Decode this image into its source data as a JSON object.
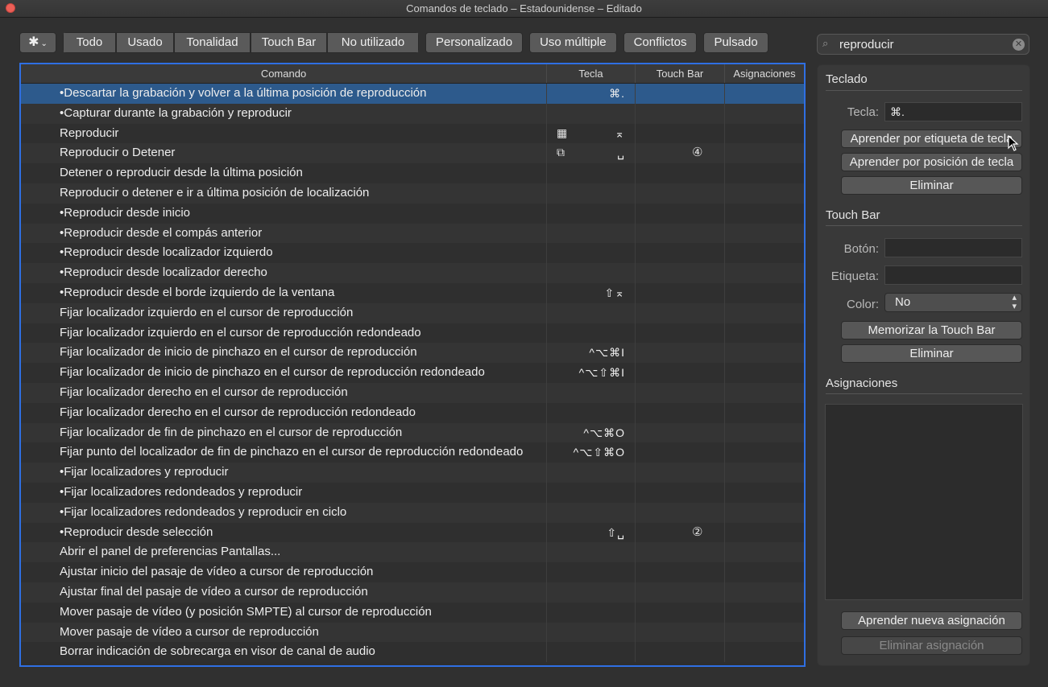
{
  "window": {
    "title": "Comandos de teclado – Estadounidense – Editado"
  },
  "toolbar": {
    "gear_icon": "gear-icon",
    "filters": [
      "Todo",
      "Usado",
      "Tonalidad",
      "Touch Bar",
      "No utilizado"
    ],
    "personalizado": "Personalizado",
    "uso_multiple": "Uso múltiple",
    "conflictos": "Conflictos",
    "pulsado": "Pulsado"
  },
  "search": {
    "value": "reproducir"
  },
  "table": {
    "headers": {
      "comando": "Comando",
      "tecla": "Tecla",
      "touch_bar": "Touch Bar",
      "asignaciones": "Asignaciones"
    },
    "rows": [
      {
        "cmd": "•Descartar la grabación y volver a la última posición de reproducción",
        "key": "⌘.",
        "icon": "",
        "tb": ""
      },
      {
        "cmd": "•Capturar durante la grabación y reproducir",
        "key": "",
        "icon": "",
        "tb": ""
      },
      {
        "cmd": "Reproducir",
        "key": "⌅",
        "icon": "▦",
        "tb": ""
      },
      {
        "cmd": "Reproducir o Detener",
        "key": "␣",
        "icon": "⧉",
        "tb": "④"
      },
      {
        "cmd": "Detener o reproducir desde la última posición",
        "key": "",
        "icon": "",
        "tb": ""
      },
      {
        "cmd": "Reproducir o detener e ir a última posición de localización",
        "key": "",
        "icon": "",
        "tb": ""
      },
      {
        "cmd": "•Reproducir desde inicio",
        "key": "",
        "icon": "",
        "tb": ""
      },
      {
        "cmd": "•Reproducir desde el compás anterior",
        "key": "",
        "icon": "",
        "tb": ""
      },
      {
        "cmd": "•Reproducir desde localizador izquierdo",
        "key": "",
        "icon": "",
        "tb": ""
      },
      {
        "cmd": "•Reproducir desde localizador derecho",
        "key": "",
        "icon": "",
        "tb": ""
      },
      {
        "cmd": "•Reproducir desde el borde izquierdo de la ventana",
        "key": "⇧⌅",
        "icon": "",
        "tb": ""
      },
      {
        "cmd": "Fijar localizador izquierdo en el cursor de reproducción",
        "key": "",
        "icon": "",
        "tb": ""
      },
      {
        "cmd": "Fijar localizador izquierdo en el cursor de reproducción redondeado",
        "key": "",
        "icon": "",
        "tb": ""
      },
      {
        "cmd": "Fijar localizador de inicio de pinchazo en el cursor de reproducción",
        "key": "^⌥⌘I",
        "icon": "",
        "tb": ""
      },
      {
        "cmd": "Fijar localizador de inicio de pinchazo en el cursor de reproducción redondeado",
        "key": "^⌥⇧⌘I",
        "icon": "",
        "tb": ""
      },
      {
        "cmd": "Fijar localizador derecho en el cursor de reproducción",
        "key": "",
        "icon": "",
        "tb": ""
      },
      {
        "cmd": "Fijar localizador derecho en el cursor de reproducción redondeado",
        "key": "",
        "icon": "",
        "tb": ""
      },
      {
        "cmd": "Fijar localizador de fin de pinchazo en el cursor de reproducción",
        "key": "^⌥⌘O",
        "icon": "",
        "tb": ""
      },
      {
        "cmd": "Fijar punto del localizador de fin de pinchazo en el cursor de reproducción redondeado",
        "key": "^⌥⇧⌘O",
        "icon": "",
        "tb": ""
      },
      {
        "cmd": "•Fijar localizadores y reproducir",
        "key": "",
        "icon": "",
        "tb": ""
      },
      {
        "cmd": "•Fijar localizadores redondeados y reproducir",
        "key": "",
        "icon": "",
        "tb": ""
      },
      {
        "cmd": "•Fijar localizadores redondeados y reproducir en ciclo",
        "key": "",
        "icon": "",
        "tb": ""
      },
      {
        "cmd": "•Reproducir desde selección",
        "key": "⇧␣",
        "icon": "",
        "tb": "②"
      },
      {
        "cmd": "Abrir el panel de preferencias Pantallas...",
        "key": "",
        "icon": "",
        "tb": ""
      },
      {
        "cmd": "Ajustar inicio del pasaje de vídeo a cursor de reproducción",
        "key": "",
        "icon": "",
        "tb": ""
      },
      {
        "cmd": "Ajustar final del pasaje de vídeo a cursor de reproducción",
        "key": "",
        "icon": "",
        "tb": ""
      },
      {
        "cmd": "Mover pasaje de vídeo (y posición SMPTE) al cursor de reproducción",
        "key": "",
        "icon": "",
        "tb": ""
      },
      {
        "cmd": "Mover pasaje de vídeo a cursor de reproducción",
        "key": "",
        "icon": "",
        "tb": ""
      },
      {
        "cmd": "Borrar indicación de sobrecarga en visor de canal de audio",
        "key": "",
        "icon": "",
        "tb": ""
      }
    ]
  },
  "panel": {
    "teclado": {
      "title": "Teclado",
      "tecla_label": "Tecla:",
      "tecla_value": "⌘.",
      "learn_label_btn": "Aprender por etiqueta de tecla",
      "learn_pos_btn": "Aprender por posición de tecla",
      "delete_btn": "Eliminar"
    },
    "touchbar": {
      "title": "Touch Bar",
      "boton_label": "Botón:",
      "etiqueta_label": "Etiqueta:",
      "color_label": "Color:",
      "color_value": "No",
      "memorize_btn": "Memorizar la Touch Bar",
      "delete_btn": "Eliminar"
    },
    "asignaciones": {
      "title": "Asignaciones",
      "learn_btn": "Aprender nueva asignación",
      "delete_btn": "Eliminar asignación"
    }
  }
}
